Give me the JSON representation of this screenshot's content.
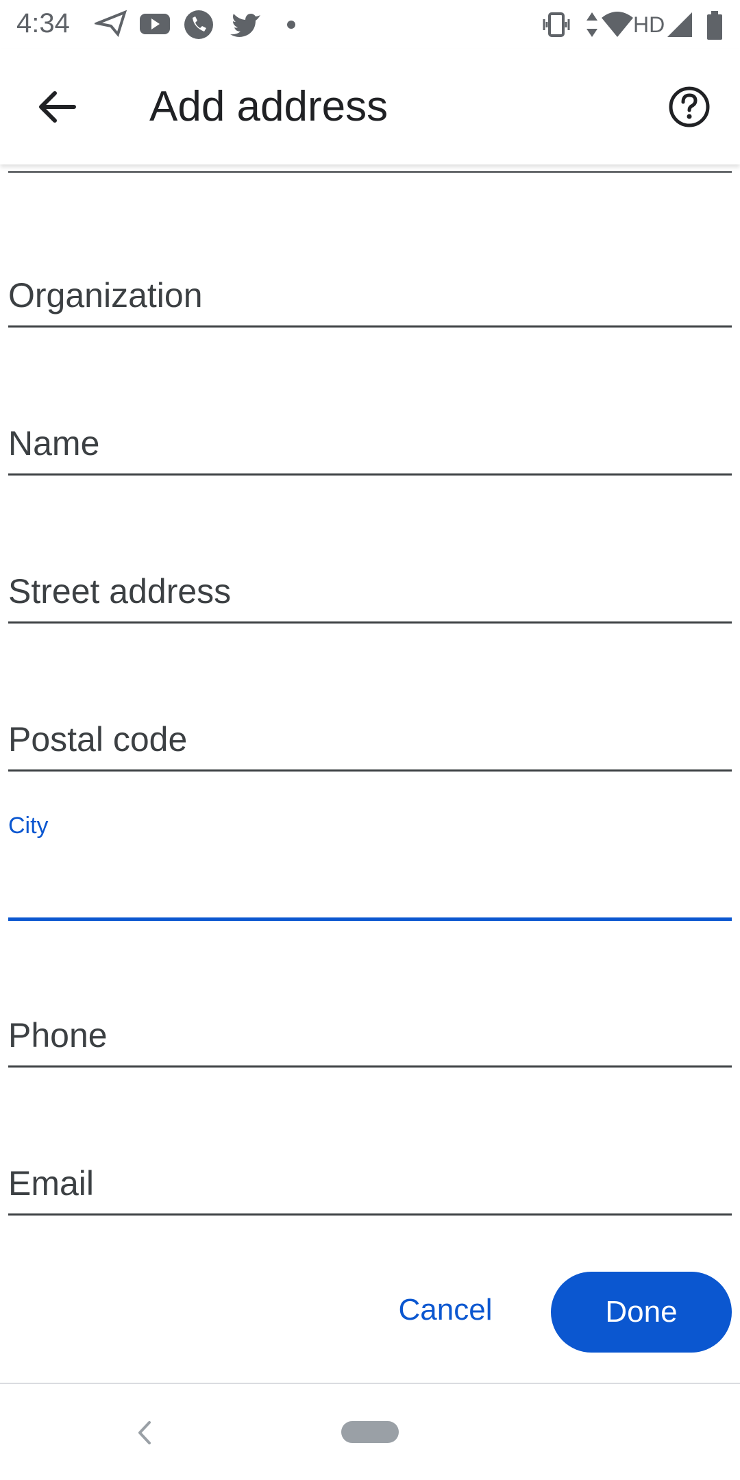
{
  "status_bar": {
    "time": "4:34",
    "network_label": "HD",
    "left_icons": [
      "send-icon",
      "youtube-icon",
      "phone-icon",
      "twitter-icon",
      "dot-icon"
    ],
    "right_icons": [
      "vibrate-icon",
      "data-arrows-icon",
      "wifi-icon",
      "signal-icon",
      "battery-icon"
    ]
  },
  "app_bar": {
    "title": "Add address",
    "back_icon": "arrow-back-icon",
    "help_icon": "help-circle-icon"
  },
  "form": {
    "fields": [
      {
        "label": "Organization",
        "value": ""
      },
      {
        "label": "Name",
        "value": ""
      },
      {
        "label": "Street address",
        "value": ""
      },
      {
        "label": "Postal code",
        "value": ""
      },
      {
        "label": "City",
        "value": "",
        "focused": true
      },
      {
        "label": "Phone",
        "value": ""
      },
      {
        "label": "Email",
        "value": ""
      }
    ]
  },
  "actions": {
    "cancel_label": "Cancel",
    "done_label": "Done"
  },
  "colors": {
    "accent": "#0b57d0",
    "text": "#3c4043",
    "background": "#ffffff"
  }
}
